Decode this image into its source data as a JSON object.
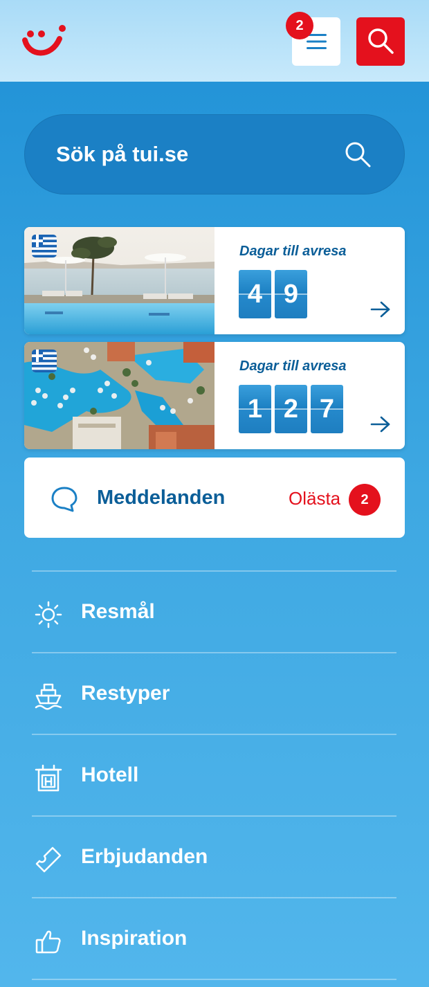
{
  "header": {
    "logo_alt": "TUI",
    "menu_badge": "2"
  },
  "search": {
    "placeholder": "Sök på tui.se"
  },
  "trips": [
    {
      "countdown_title": "Dagar till avresa",
      "digits": [
        "4",
        "9"
      ]
    },
    {
      "countdown_title": "Dagar till avresa",
      "digits": [
        "1",
        "2",
        "7"
      ]
    }
  ],
  "messages": {
    "title": "Meddelanden",
    "unread_label": "Olästa",
    "unread_count": "2"
  },
  "nav": [
    {
      "label": "Resmål",
      "icon": "sun-icon"
    },
    {
      "label": "Restyper",
      "icon": "ship-icon"
    },
    {
      "label": "Hotell",
      "icon": "hotel-icon"
    },
    {
      "label": "Erbjudanden",
      "icon": "ticket-icon"
    },
    {
      "label": "Inspiration",
      "icon": "thumbs-up-icon"
    }
  ],
  "colors": {
    "brand_red": "#e4111d",
    "brand_blue": "#0b5e98",
    "background_blue": "#1e90d6"
  }
}
